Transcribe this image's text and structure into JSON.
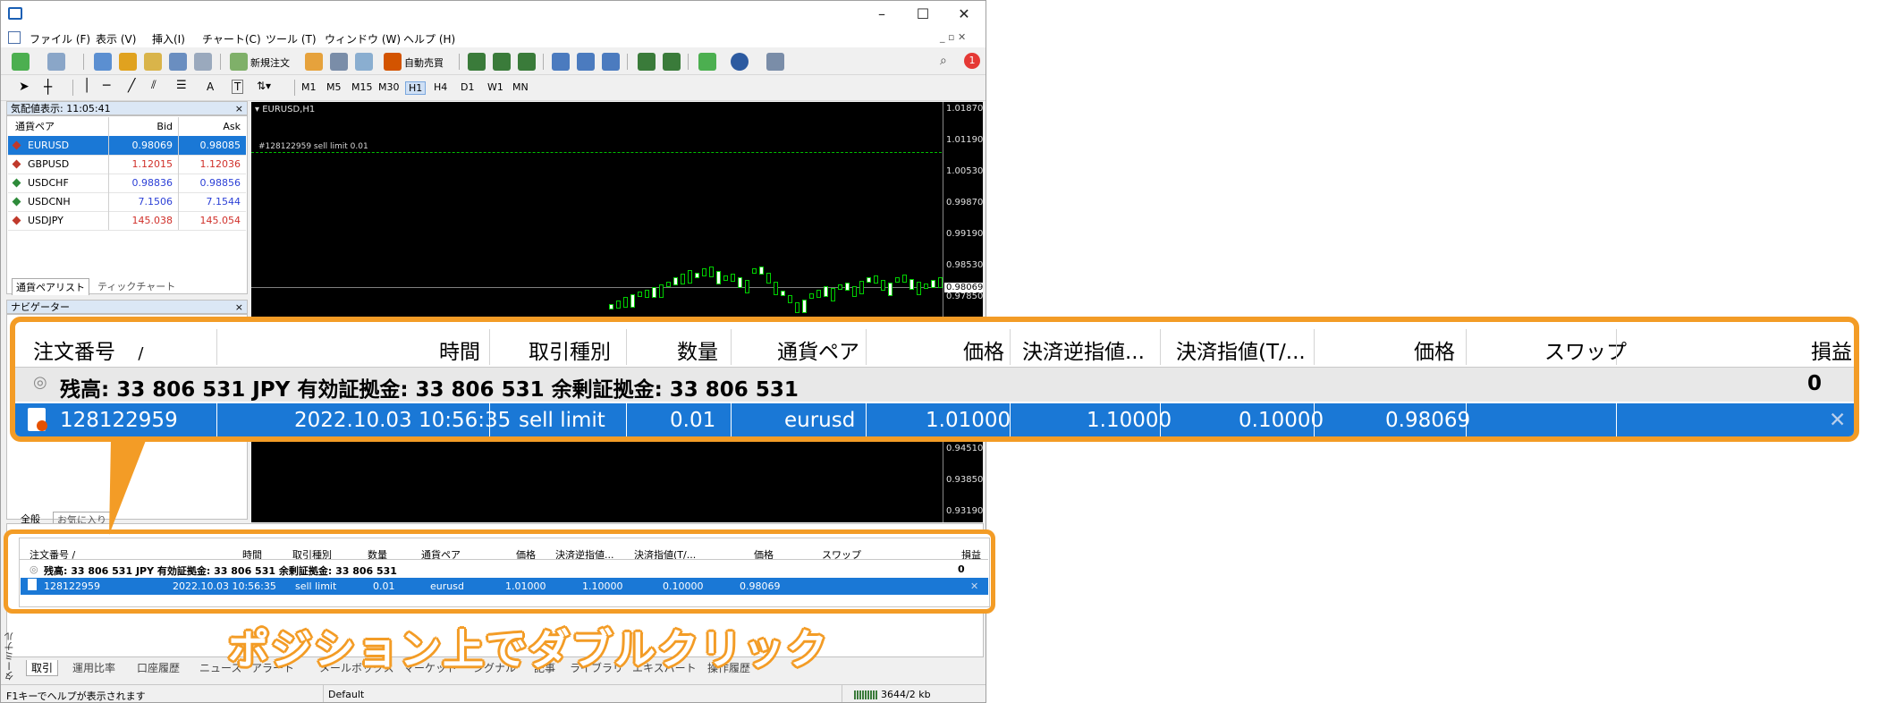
{
  "window": {
    "min_label": "–",
    "max_label": "☐",
    "close_label": "✕"
  },
  "menu": [
    "ファイル (F)",
    "表示 (V)",
    "挿入(I)",
    "チャート(C)",
    "ツール (T)",
    "ウィンドウ (W)",
    "ヘルプ (H)"
  ],
  "toolbar": {
    "new_order": "新規注文",
    "auto_trade": "自動売買",
    "notification_count": "1",
    "timeframes": [
      "M1",
      "M5",
      "M15",
      "M30",
      "H1",
      "H4",
      "D1",
      "W1",
      "MN"
    ]
  },
  "market_watch": {
    "title": "気配値表示: 11:05:41",
    "col_symbol": "通貨ペア",
    "col_bid": "Bid",
    "col_ask": "Ask",
    "rows": [
      {
        "symbol": "EURUSD",
        "bid": "0.98069",
        "ask": "0.98085",
        "color": "#c0392b"
      },
      {
        "symbol": "GBPUSD",
        "bid": "1.12015",
        "ask": "1.12036",
        "color": "#c0392b"
      },
      {
        "symbol": "USDCHF",
        "bid": "0.98836",
        "ask": "0.98856",
        "color": "#2e8b3a"
      },
      {
        "symbol": "USDCNH",
        "bid": "7.1506",
        "ask": "7.1544",
        "color": "#2e8b3a"
      },
      {
        "symbol": "USDJPY",
        "bid": "145.038",
        "ask": "145.054",
        "color": "#c0392b"
      }
    ],
    "tab_symbols": "通貨ペアリスト",
    "tab_tick": "ティックチャート"
  },
  "navigator": {
    "title": "ナビゲーター",
    "tab_all": "全般",
    "tab_fav": "お気に入り"
  },
  "chart": {
    "title": "EURUSD,H1",
    "order_line_label": "#128122959 sell limit 0.01",
    "current_price": "0.98069",
    "price_labels": [
      "1.01870",
      "1.01190",
      "1.00530",
      "0.99870",
      "0.99190",
      "0.98530",
      "0.97850",
      "0.94510",
      "0.93850",
      "0.93190"
    ]
  },
  "terminal": {
    "headers": {
      "ticket": "注文番号",
      "sort": "/",
      "time": "時間",
      "type": "取引種別",
      "volume": "数量",
      "symbol": "通貨ペア",
      "price": "価格",
      "sl": "決済逆指値...",
      "tp": "決済指値(T/...",
      "price2": "価格",
      "swap": "スワップ",
      "profit": "損益"
    },
    "summary": "残高: 33 806 531 JPY  有効証拠金: 33 806 531  余剰証拠金: 33 806 531",
    "summary_profit": "0",
    "row": {
      "ticket": "128122959",
      "time": "2022.10.03 10:56:35",
      "type": "sell limit",
      "volume": "0.01",
      "symbol": "eurusd",
      "price": "1.01000",
      "sl": "1.10000",
      "tp": "0.10000",
      "price2": "0.98069",
      "swap": "",
      "close": "✕"
    },
    "side_label": "ターミナル",
    "tabs": [
      "取引",
      "運用比率",
      "口座履歴",
      "ニュース",
      "アラート",
      "メールボックス",
      "マーケット",
      "シグナル",
      "記事",
      "ライブラリ",
      "エキスパート",
      "操作履歴"
    ]
  },
  "callout": "ポジション上でダブルクリック",
  "status": {
    "help": "F1キーでヘルプが表示されます",
    "profile": "Default",
    "traffic": "3644/2 kb"
  },
  "colors": {
    "accent": "#f39c26",
    "selection": "#1a78d6"
  }
}
